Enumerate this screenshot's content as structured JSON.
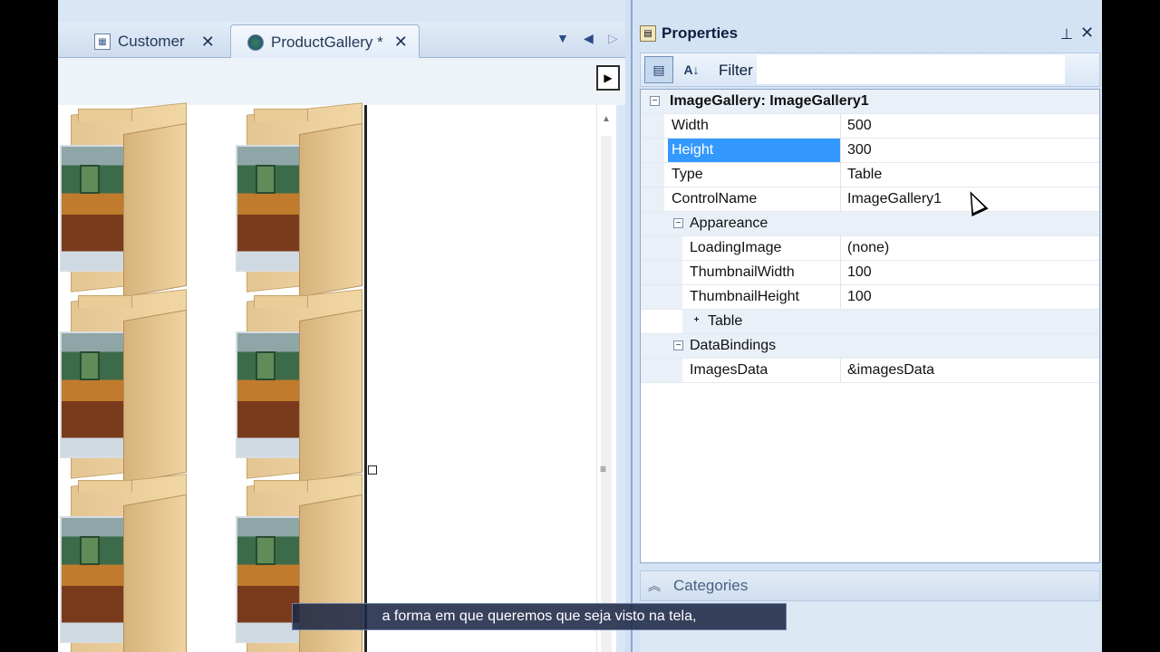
{
  "tabs": [
    {
      "label": "Customer",
      "icon": "table-icon"
    },
    {
      "label": "ProductGallery *",
      "icon": "web-form-icon"
    }
  ],
  "tab_nav": {
    "dropdown": "▼",
    "left": "◀",
    "right": "▷"
  },
  "editor": {
    "run_glyph": "▶"
  },
  "properties": {
    "title": "Properties",
    "pin": "🖈",
    "close": "✕",
    "filter_label": "Filter",
    "filter_value": "",
    "object_header": "ImageGallery: ImageGallery1",
    "rows": [
      {
        "name": "Width",
        "value": "500"
      },
      {
        "name": "Height",
        "value": "300"
      },
      {
        "name": "Type",
        "value": "Table"
      },
      {
        "name": "ControlName",
        "value": "ImageGallery1"
      }
    ],
    "appearance": {
      "label": "Appareance",
      "rows": [
        {
          "name": "LoadingImage",
          "value": "(none)"
        },
        {
          "name": "ThumbnailWidth",
          "value": "100"
        },
        {
          "name": "ThumbnailHeight",
          "value": "100"
        }
      ],
      "table_group": "Table"
    },
    "databindings": {
      "label": "DataBindings",
      "rows": [
        {
          "name": "ImagesData",
          "value": "&imagesData"
        }
      ]
    },
    "categories_label": "Categories"
  },
  "subtitle": "a forma em que queremos que seja visto na tela,"
}
